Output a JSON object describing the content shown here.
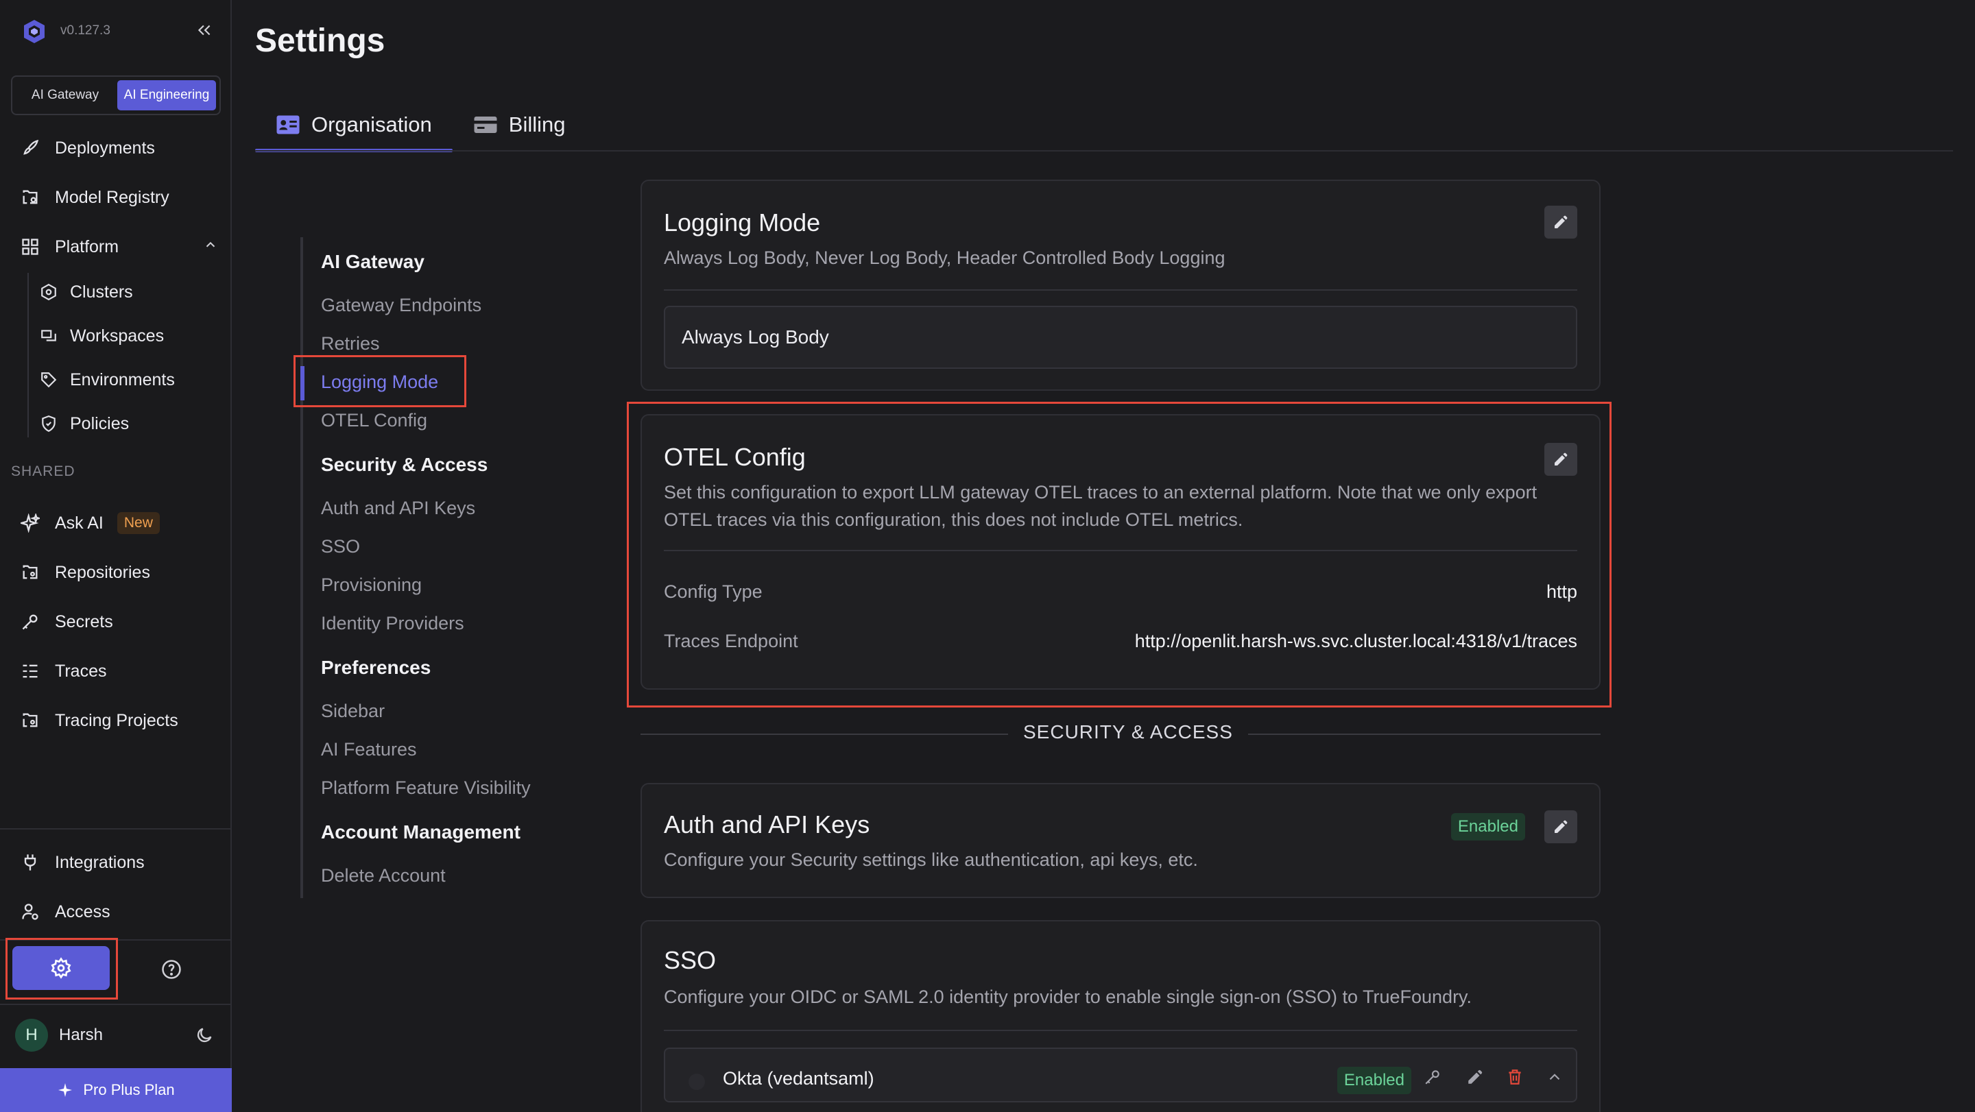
{
  "sidebar": {
    "version": "v0.127.3",
    "modes": [
      "AI Gateway",
      "AI Engineering"
    ],
    "active_mode": "AI Engineering",
    "nav": [
      {
        "label": "Deployments",
        "icon": "rocket-icon"
      },
      {
        "label": "Model Registry",
        "icon": "model-registry-icon"
      },
      {
        "label": "Platform",
        "icon": "grid-icon"
      }
    ],
    "platform_items": [
      {
        "label": "Clusters",
        "icon": "cluster-icon"
      },
      {
        "label": "Workspaces",
        "icon": "workspace-icon"
      },
      {
        "label": "Environments",
        "icon": "tag-icon"
      },
      {
        "label": "Policies",
        "icon": "shield-icon"
      }
    ],
    "shared_label": "SHARED",
    "shared_items": [
      {
        "label": "Ask AI",
        "icon": "sparkle-icon",
        "badge": "New"
      },
      {
        "label": "Repositories",
        "icon": "repository-icon"
      },
      {
        "label": "Secrets",
        "icon": "key-icon"
      },
      {
        "label": "Traces",
        "icon": "traces-icon"
      },
      {
        "label": "Tracing Projects",
        "icon": "tracing-projects-icon"
      }
    ],
    "bottom_items": [
      {
        "label": "Integrations",
        "icon": "plug-icon"
      },
      {
        "label": "Access",
        "icon": "user-access-icon"
      }
    ],
    "user": {
      "initial": "H",
      "name": "Harsh"
    },
    "plan": "Pro Plus Plan"
  },
  "header": {
    "title": "Settings",
    "tabs": [
      {
        "label": "Organisation",
        "icon": "id-card-icon"
      },
      {
        "label": "Billing",
        "icon": "credit-card-icon"
      }
    ],
    "active_tab": "Organisation"
  },
  "toc": {
    "sections": [
      {
        "heading": "AI Gateway",
        "items": [
          "Gateway Endpoints",
          "Retries",
          "Logging Mode",
          "OTEL Config"
        ]
      },
      {
        "heading": "Security & Access",
        "items": [
          "Auth and API Keys",
          "SSO",
          "Provisioning",
          "Identity Providers"
        ]
      },
      {
        "heading": "Preferences",
        "items": [
          "Sidebar",
          "AI Features",
          "Platform Feature Visibility"
        ]
      },
      {
        "heading": "Account Management",
        "items": [
          "Delete Account"
        ]
      }
    ],
    "active_item": "Logging Mode"
  },
  "logging_mode": {
    "title": "Logging Mode",
    "description": "Always Log Body, Never Log Body, Header Controlled Body Logging",
    "value": "Always Log Body"
  },
  "otel_config": {
    "title": "OTEL Config",
    "description": "Set this configuration to export LLM gateway OTEL traces to an external platform. Note that we only export OTEL traces via this configuration, this does not include OTEL metrics.",
    "config_type_label": "Config Type",
    "config_type_value": "http",
    "endpoint_label": "Traces Endpoint",
    "endpoint_value": "http://openlit.harsh-ws.svc.cluster.local:4318/v1/traces"
  },
  "security_section_label": "SECURITY & ACCESS",
  "auth_keys": {
    "title": "Auth and API Keys",
    "description": "Configure your Security settings like authentication, api keys, etc.",
    "status": "Enabled"
  },
  "sso": {
    "title": "SSO",
    "description": "Configure your OIDC or SAML 2.0 identity provider to enable single sign-on (SSO) to TrueFoundry.",
    "provider_name": "Okta (vedantsaml)",
    "provider_status": "Enabled"
  },
  "colors": {
    "accent": "#5b5bd6",
    "highlight": "#e5483a",
    "success": "#6cd49a"
  }
}
